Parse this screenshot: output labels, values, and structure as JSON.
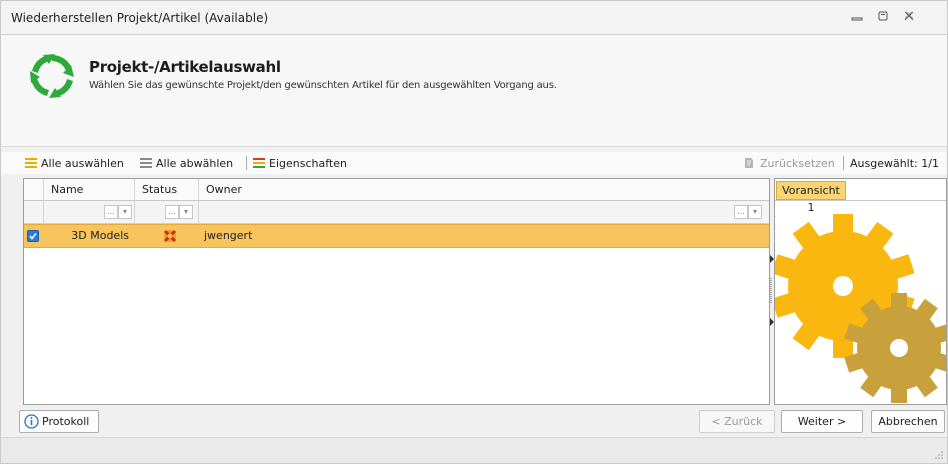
{
  "window": {
    "title": "Wiederherstellen Projekt/Artikel (Available)"
  },
  "header": {
    "title": "Projekt-/Artikelauswahl",
    "subtitle": "Wählen Sie das gewünschte Projekt/den gewünschten Artikel für den ausgewählten Vorgang aus."
  },
  "toolbar": {
    "select_all": "Alle auswählen",
    "deselect_all": "Alle abwählen",
    "properties": "Eigenschaften",
    "reset": "Zurücksetzen",
    "selected_count": "Ausgewählt: 1/1"
  },
  "grid": {
    "columns": [
      "Name",
      "Status",
      "Owner"
    ],
    "rows": [
      {
        "checked": true,
        "name": "3D Models",
        "status_icon": "status-icon",
        "owner": "jwengert"
      }
    ]
  },
  "preview": {
    "tab_label": "Voransicht 1"
  },
  "buttons": {
    "protocol": "Protokoll",
    "back": "< Zurück",
    "next": "Weiter >",
    "cancel": "Abbrechen"
  },
  "colors": {
    "selection": "#f7c45e",
    "accent_green": "#2eaa3a",
    "gear_large": "#f9b70f",
    "gear_small": "#c8a13d"
  }
}
